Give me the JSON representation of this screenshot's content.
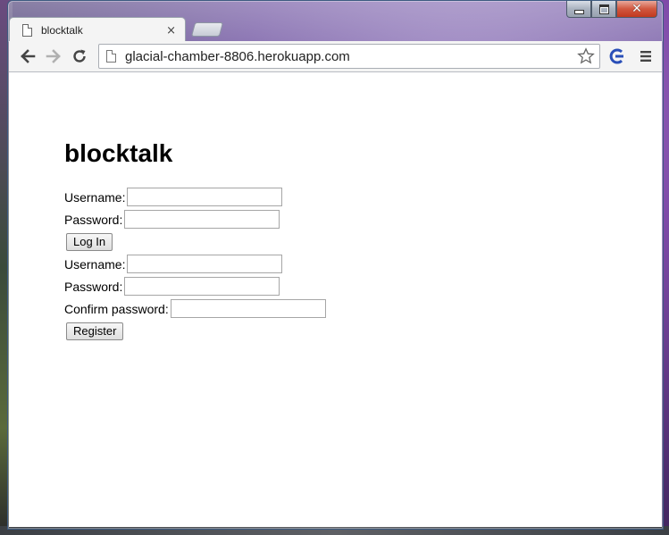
{
  "browser": {
    "tab_title": "blocktalk",
    "tab_close": "×",
    "url": "glacial-chamber-8806.herokuapp.com"
  },
  "page": {
    "heading": "blocktalk",
    "login": {
      "username_label": "Username:",
      "password_label": "Password:",
      "username_value": "",
      "password_value": "",
      "submit_label": "Log In"
    },
    "register": {
      "username_label": "Username:",
      "password_label": "Password:",
      "confirm_label": "Confirm password:",
      "username_value": "",
      "password_value": "",
      "confirm_value": "",
      "submit_label": "Register"
    }
  },
  "icons": {
    "back": "arrow-left-icon",
    "forward": "arrow-right-icon",
    "reload": "reload-icon",
    "bookmark": "star-icon",
    "extension": "extension-icon",
    "menu": "hamburger-menu-icon"
  },
  "colors": {
    "nav_active": "#444444",
    "nav_disabled": "#b0b0b0",
    "extension_blue": "#2a4fb8"
  }
}
